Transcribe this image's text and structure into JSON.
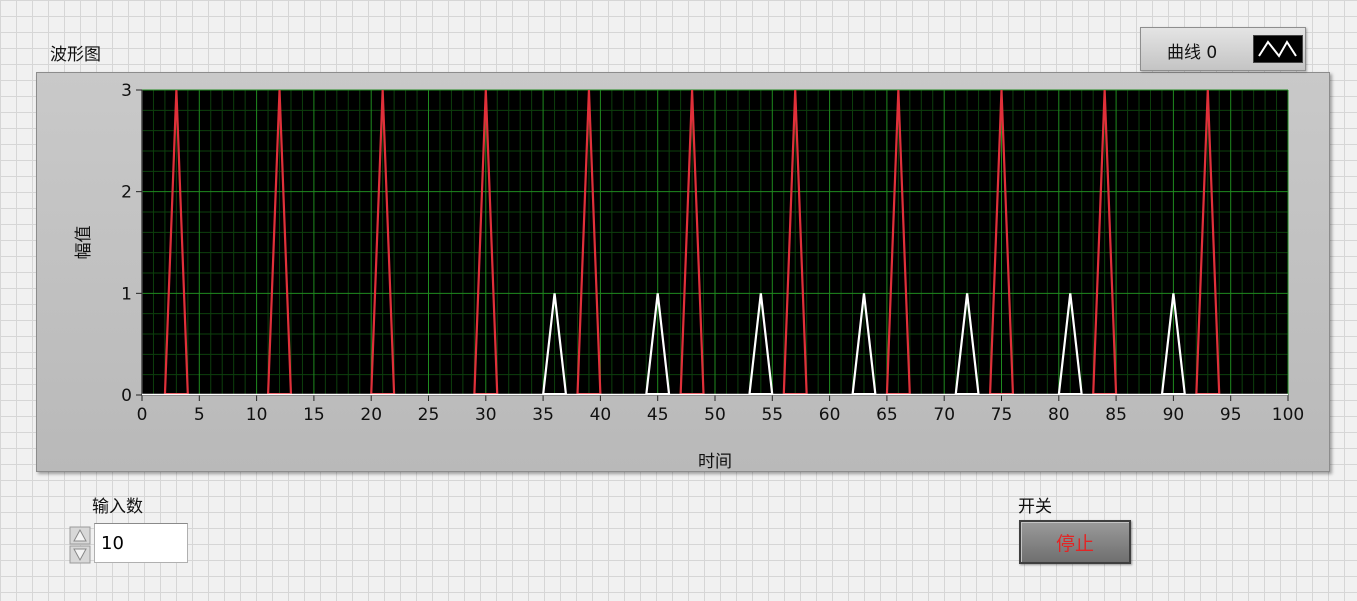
{
  "graph": {
    "title": "波形图",
    "legend": {
      "label": "曲线 0",
      "icon": "waveform-line-icon"
    },
    "plot_background": "#000000",
    "grid_major_color": "#1f8a1f",
    "grid_minor_color": "#0d3f0d"
  },
  "chart_data": {
    "type": "line",
    "xlabel": "时间",
    "ylabel": "幅值",
    "xlim": [
      0,
      100
    ],
    "ylim": [
      0,
      3
    ],
    "xticks": [
      0,
      5,
      10,
      15,
      20,
      25,
      30,
      35,
      40,
      45,
      50,
      55,
      60,
      65,
      70,
      75,
      80,
      85,
      90,
      95,
      100
    ],
    "yticks": [
      0,
      1,
      2,
      3
    ],
    "grid": true,
    "legend_position": "top-right",
    "series": [
      {
        "name": "曲线 0",
        "color": "#e0303a",
        "peak": 3,
        "peak_x": [
          3,
          12,
          21,
          30,
          39,
          48,
          57,
          66,
          75,
          84,
          93
        ],
        "half_width": 1
      },
      {
        "color": "#ffffff",
        "peak": 1,
        "peak_x": [
          36,
          45,
          54,
          63,
          72,
          81,
          90
        ],
        "half_width": 1
      }
    ]
  },
  "controls": {
    "input_label": "输入数",
    "input_value": "10",
    "switch_label": "开关",
    "stop_label": "停止",
    "stop_color": "#e22525"
  }
}
